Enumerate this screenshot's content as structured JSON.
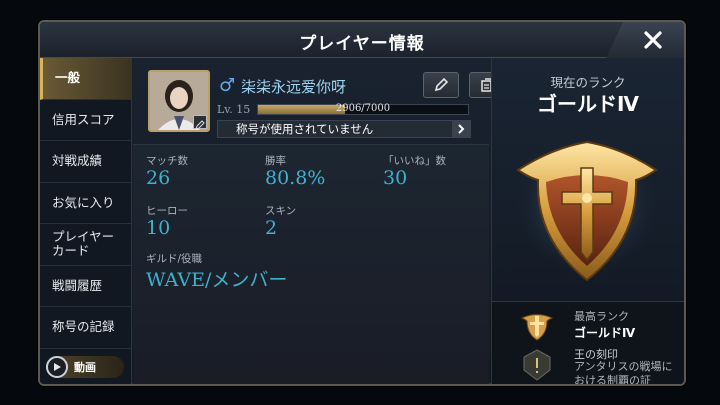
{
  "window": {
    "title": "プレイヤー情報"
  },
  "sidebar": {
    "items": [
      {
        "label": "一般",
        "active": true
      },
      {
        "label": "信用スコア",
        "active": false
      },
      {
        "label": "対戦成績",
        "active": false
      },
      {
        "label": "お気に入り",
        "active": false
      },
      {
        "label": "プレイヤーカード",
        "active": false
      },
      {
        "label": "戦闘履歴",
        "active": false
      },
      {
        "label": "称号の記録",
        "active": false
      }
    ],
    "video_label": "動画"
  },
  "player": {
    "name": "柒柒永远爱你呀",
    "gender_symbol": "♂",
    "level_label": "Lv. 15",
    "xp_text": "2906/7000",
    "xp_fraction": 0.415,
    "title_text": "称号が使用されていません"
  },
  "stats": {
    "match_label": "マッチ数",
    "match_value": "26",
    "winrate_label": "勝率",
    "winrate_value": "80.8%",
    "likes_label": "「いいね」数",
    "likes_value": "30",
    "hero_label": "ヒーロー",
    "hero_value": "10",
    "skin_label": "スキン",
    "skin_value": "2",
    "guild_label": "ギルド/役職",
    "guild_value": "WAVE/メンバー"
  },
  "rank": {
    "current_caption": "現在のランク",
    "current_name": "ゴールドⅣ",
    "highest_label": "最高ランク",
    "highest_value": "ゴールドⅣ",
    "seal_label": "王の刻印",
    "seal_desc": "アンタリスの戦場における制覇の証"
  },
  "colors": {
    "accent_gold": "#d9b35c",
    "stat_value": "#3fb2cf",
    "name_blue": "#9fd2f0"
  },
  "icons": [
    "close-icon",
    "play-icon",
    "pencil-icon",
    "card-icon",
    "chevron-right-icon",
    "gold-rank-emblem",
    "mini-rank-icon",
    "seal-icon"
  ]
}
